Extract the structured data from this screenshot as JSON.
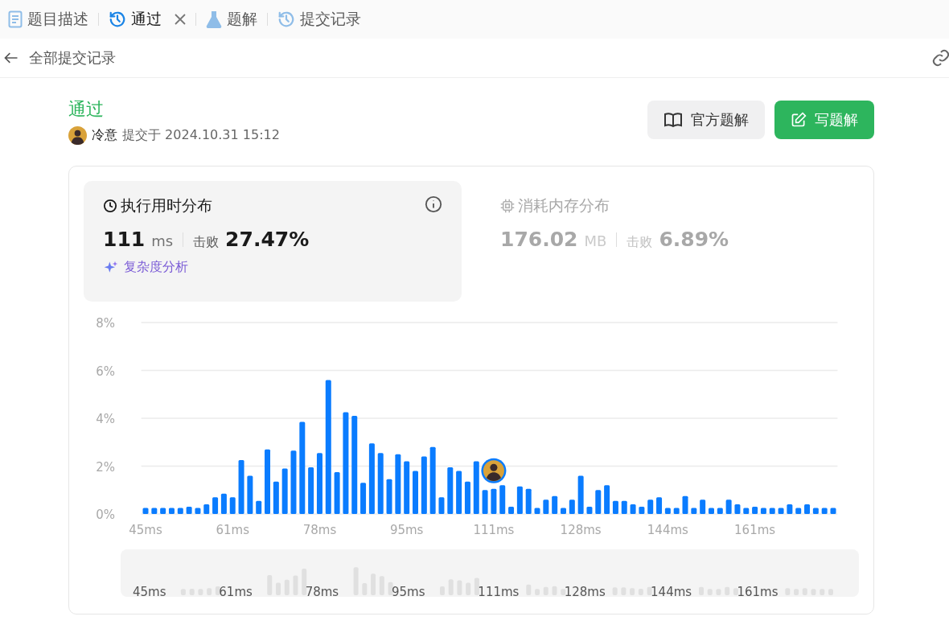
{
  "tabs": [
    {
      "label": "题目描述",
      "kind": "description",
      "selected": false,
      "closable": false
    },
    {
      "label": "通过",
      "kind": "result",
      "selected": true,
      "closable": true
    },
    {
      "label": "题解",
      "kind": "solutions",
      "selected": false,
      "closable": false
    },
    {
      "label": "提交记录",
      "kind": "submissions",
      "selected": false,
      "closable": false
    }
  ],
  "back_link": "全部提交记录",
  "result": {
    "status": "通过",
    "user": "冷意",
    "submitted": "提交于 2024.10.31 15:12"
  },
  "buttons": [
    {
      "label": "官方题解",
      "kind": "secondary"
    },
    {
      "label": "写题解",
      "kind": "primary"
    }
  ],
  "stats": [
    {
      "kind": "runtime",
      "title": "执行用时分布",
      "value": "111",
      "unit": "ms",
      "beat_label": "击败",
      "beat": "27.47%",
      "selected": true,
      "analysis": "复杂度分析"
    },
    {
      "kind": "memory",
      "title": "消耗内存分布",
      "value": "176.02",
      "unit": "MB",
      "beat_label": "击败",
      "beat": "6.89%",
      "selected": false
    }
  ],
  "chart_data": {
    "type": "bar",
    "ylim": [
      0,
      8
    ],
    "grid": true,
    "yticks": [
      {
        "value": 0,
        "label": "0%"
      },
      {
        "value": 2,
        "label": "2%"
      },
      {
        "value": 4,
        "label": "4%"
      },
      {
        "value": 6,
        "label": "6%"
      },
      {
        "value": 8,
        "label": "8%"
      }
    ],
    "values": [
      0.25,
      0.25,
      0.25,
      0.25,
      0.25,
      0.3,
      0.25,
      0.4,
      0.7,
      0.85,
      0.7,
      2.25,
      1.6,
      0.55,
      2.7,
      1.35,
      1.9,
      2.65,
      3.85,
      1.95,
      2.55,
      5.6,
      1.75,
      4.25,
      4.1,
      1.3,
      2.95,
      2.55,
      1.45,
      2.5,
      2.2,
      1.8,
      2.4,
      2.8,
      0.7,
      1.95,
      1.8,
      1.35,
      2.2,
      1.0,
      1.05,
      1.2,
      0.3,
      1.15,
      1.05,
      0.25,
      0.6,
      0.75,
      0.25,
      0.6,
      1.6,
      0.3,
      1.0,
      1.2,
      0.55,
      0.55,
      0.4,
      0.3,
      0.6,
      0.7,
      0.25,
      0.25,
      0.75,
      0.25,
      0.6,
      0.25,
      0.25,
      0.6,
      0.4,
      0.25,
      0.3,
      0.25,
      0.25,
      0.25,
      0.4,
      0.25,
      0.4,
      0.25,
      0.25,
      0.25
    ]
  },
  "x_axis_labels": [
    "45ms",
    "61ms",
    "78ms",
    "95ms",
    "111ms",
    "128ms",
    "144ms",
    "161ms"
  ],
  "overview": {
    "labels": [
      "45ms",
      "61ms",
      "78ms",
      "95ms",
      "111ms",
      "128ms",
      "144ms",
      "161ms"
    ]
  }
}
